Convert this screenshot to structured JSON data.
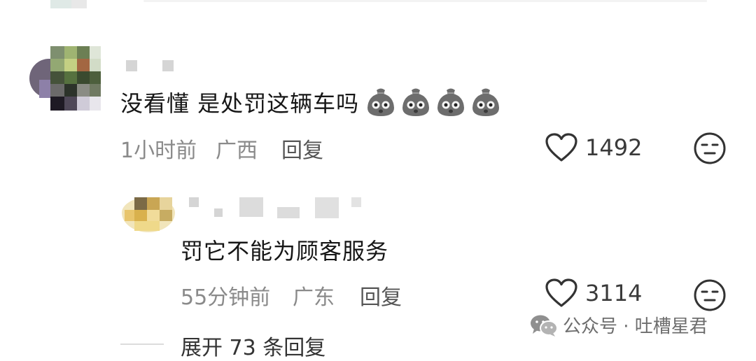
{
  "comments": [
    {
      "text": "没看懂 是处罚这辆车吗",
      "emoji_name": "flushed-pouch-emoji",
      "time": "1小时前",
      "location": "广西",
      "reply_label": "回复",
      "likes": "1492"
    },
    {
      "text": "罚它不能为顾客服务",
      "time": "55分钟前",
      "location": "广东",
      "reply_label": "回复",
      "likes": "3114"
    }
  ],
  "expand_replies_label": "展开 73 条回复",
  "watermark": {
    "icon": "wechat-icon",
    "text": "公众号 · 吐槽星君"
  },
  "icons": {
    "like": "heart-outline-icon",
    "dislike": "unamused-face-icon"
  }
}
